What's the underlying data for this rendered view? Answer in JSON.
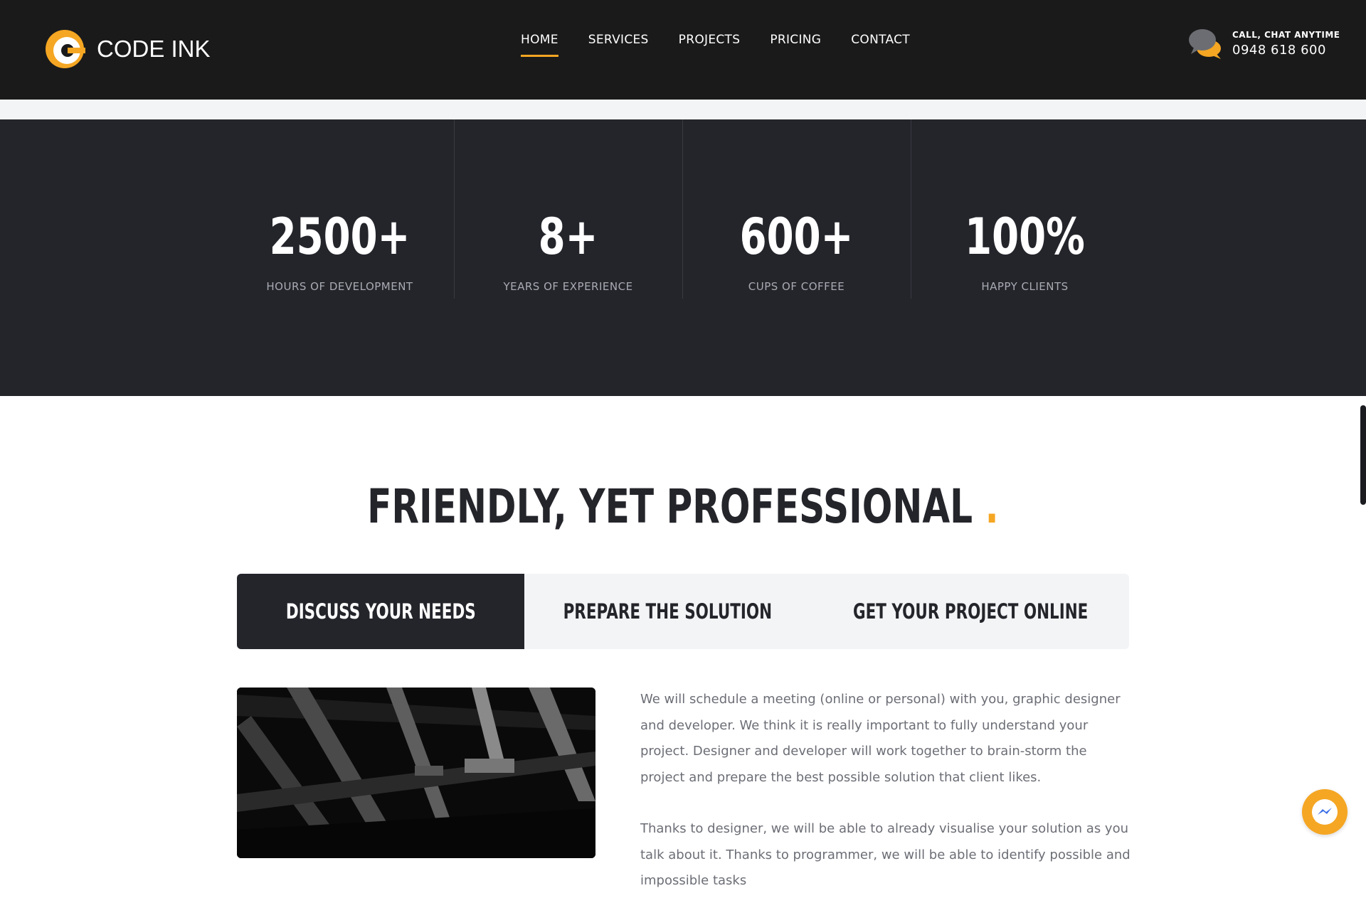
{
  "header": {
    "logo_text": "CODE INK",
    "nav": [
      {
        "label": "HOME",
        "active": true
      },
      {
        "label": "SERVICES",
        "active": false
      },
      {
        "label": "PROJECTS",
        "active": false
      },
      {
        "label": "PRICING",
        "active": false
      },
      {
        "label": "CONTACT",
        "active": false
      }
    ],
    "contact_label": "CALL, CHAT ANYTIME",
    "contact_phone": "0948 618 600"
  },
  "stats": [
    {
      "value": "2500+",
      "label": "HOURS OF DEVELOPMENT"
    },
    {
      "value": "8+",
      "label": "YEARS OF EXPERIENCE"
    },
    {
      "value": "600+",
      "label": "CUPS OF COFFEE"
    },
    {
      "value": "100%",
      "label": "HAPPY CLIENTS"
    }
  ],
  "headline": {
    "text": "FRIENDLY, YET PROFESSIONAL",
    "dot": "."
  },
  "tabs": [
    {
      "label": "DISCUSS YOUR NEEDS",
      "active": true
    },
    {
      "label": "PREPARE THE SOLUTION",
      "active": false
    },
    {
      "label": "GET YOUR PROJECT ONLINE",
      "active": false
    }
  ],
  "content": {
    "paragraph_1": "We will schedule a meeting (online or personal) with you, graphic designer and developer. We think it is really important to fully understand your project. Designer and developer will work together to brain-storm the project and prepare the best possible solution that client likes.",
    "paragraph_2": "Thanks to designer, we will be able to already visualise your solution as you talk about it. Thanks to programmer, we will be able to identify possible and impossible tasks"
  },
  "colors": {
    "accent": "#f5a623",
    "header_bg": "#1a1a1a",
    "dark_section": "#24252b",
    "tab_bg": "#f3f4f6"
  },
  "icons": {
    "chat": "chat-bubbles-icon",
    "messenger": "messenger-icon",
    "logo": "code-ink-logo-icon"
  }
}
